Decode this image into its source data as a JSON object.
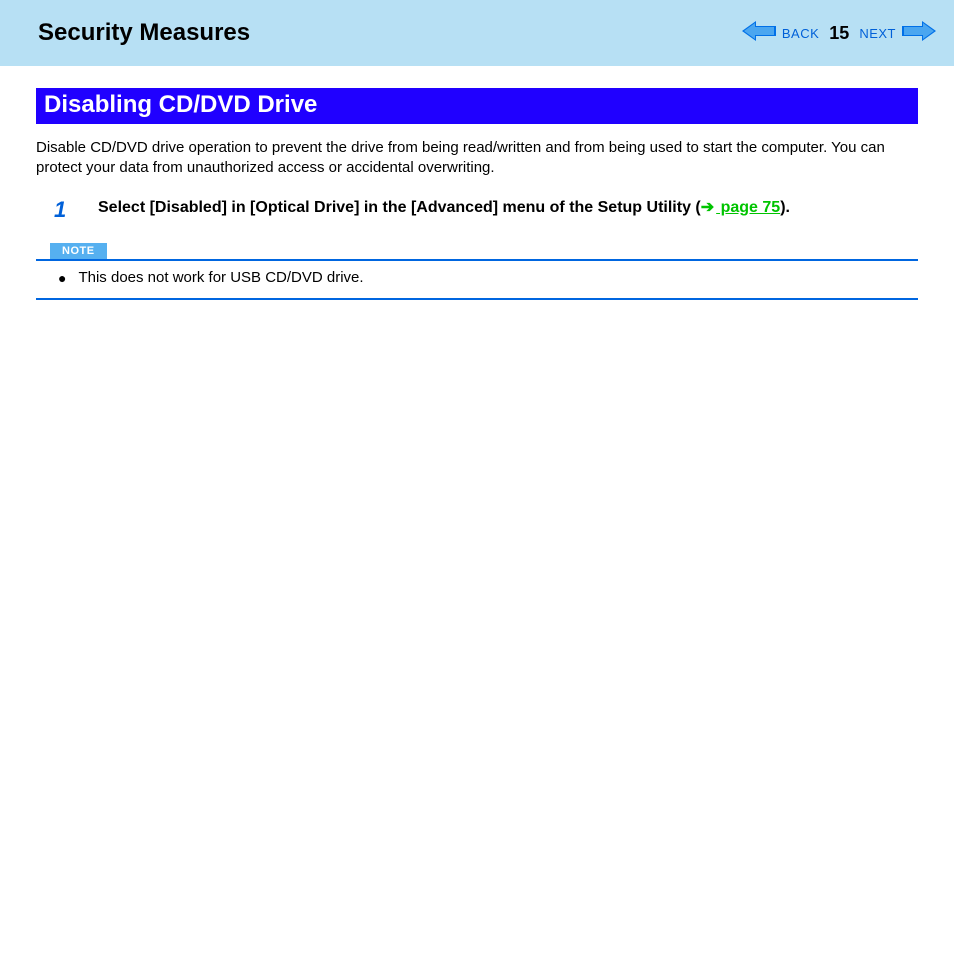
{
  "header": {
    "title": "Security Measures",
    "back_label": "BACK",
    "next_label": "NEXT",
    "page_number": "15"
  },
  "section": {
    "heading": "Disabling CD/DVD Drive",
    "intro": "Disable CD/DVD drive operation to prevent the drive from being read/written and from being used to start the computer. You can protect your data from unauthorized access or accidental overwriting."
  },
  "step": {
    "number": "1",
    "text_a": "Select [Disabled] in [Optical Drive] in the [Advanced] menu of the Setup Utility (",
    "page_ref": " page 75",
    "text_b": ")."
  },
  "note": {
    "label": "NOTE",
    "item": "This does not work for USB CD/DVD drive."
  }
}
